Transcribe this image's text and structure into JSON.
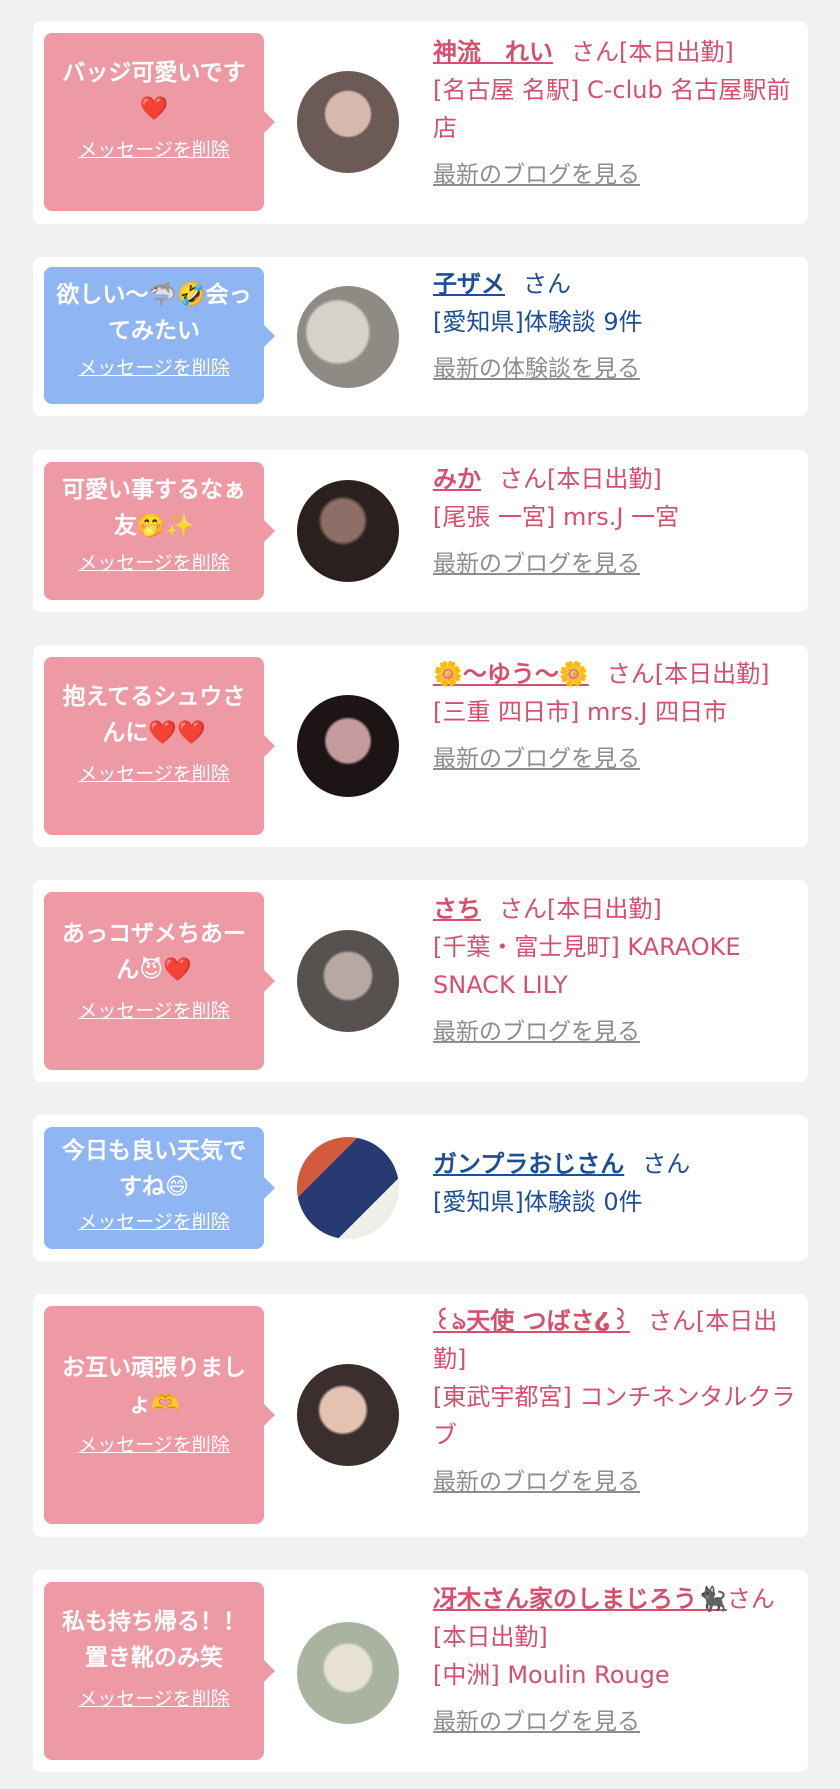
{
  "delete_label": "メッセージを削除",
  "cards": [
    {
      "theme": "pink",
      "message": "バッジ可愛いです❤️",
      "name": "神流　れい",
      "suffix": "さん[本日出勤]",
      "detail": "[名古屋 名駅] C-club 名古屋駅前店",
      "link": "最新のブログを見る",
      "avatar_colors": [
        "#6b5a55",
        "#d7b8ad"
      ]
    },
    {
      "theme": "blue",
      "message": "欲しい〜🦈🤣会ってみたい",
      "name": "子ザメ",
      "suffix": "さん",
      "detail": "[愛知県]体験談 9件",
      "link": "最新の体験談を見る",
      "avatar_colors": [
        "#8f8a83",
        "#d7d2c9"
      ]
    },
    {
      "theme": "pink",
      "message": "可愛い事するなぁ友🤭✨",
      "name": "みか",
      "suffix": "さん[本日出勤]",
      "detail": "[尾張 一宮] mrs.J 一宮",
      "link": "最新のブログを見る",
      "avatar_colors": [
        "#2a201d",
        "#8d6f67"
      ]
    },
    {
      "theme": "pink",
      "message": "抱えてるシュウさんに❤️❤️",
      "name": "🌼〜ゆう〜🌼",
      "suffix": "さん[本日出勤]",
      "detail": "[三重 四日市] mrs.J 四日市",
      "link": "最新のブログを見る",
      "avatar_colors": [
        "#1d1515",
        "#c49a9d"
      ]
    },
    {
      "theme": "pink",
      "message": "あっコザメちあーん😈❤️",
      "name": "さち",
      "suffix": "さん[本日出勤]",
      "detail": "[千葉・富士見町] KARAOKE SNACK LILY",
      "link": "最新のブログを見る",
      "avatar_colors": [
        "#57524f",
        "#b7a8a2"
      ]
    },
    {
      "theme": "blue",
      "message": "今日も良い天気ですね😄",
      "name": "ガンプラおじさん",
      "suffix": "さん",
      "detail": "[愛知県]体験談 0件",
      "link": "",
      "avatar_colors": [
        "#283a72",
        "#d25b3d"
      ]
    },
    {
      "theme": "pink",
      "message": "お互い頑張りましょ🫶",
      "name": "꒰ঌ天使 つばさ໒꒱",
      "suffix": "さん[本日出勤]",
      "detail": "[東武宇都宮] コンチネンタルクラブ",
      "link": "最新のブログを見る",
      "avatar_colors": [
        "#3a2f2d",
        "#e3c2b2"
      ]
    },
    {
      "theme": "pink",
      "message": "私も持ち帰る！！置き靴のみ笑",
      "name": "冴木さん家のしまじろう🐈‍⬛",
      "suffix": "さん[本日出勤]",
      "detail": "[中洲] Moulin Rouge",
      "link": "最新のブログを見る",
      "avatar_colors": [
        "#a9b39f",
        "#e7e1d3"
      ]
    }
  ]
}
